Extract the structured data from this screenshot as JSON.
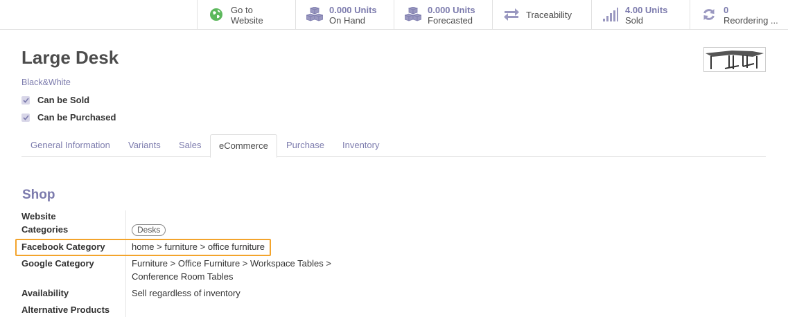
{
  "smart_buttons": [
    {
      "value": "",
      "label_line1": "Go to",
      "label_line2": "Website",
      "icon": "globe-icon"
    },
    {
      "value": "0.000 Units",
      "label": "On Hand",
      "icon": "cubes-icon"
    },
    {
      "value": "0.000 Units",
      "label": "Forecasted",
      "icon": "cubes-icon"
    },
    {
      "value": "",
      "label": "Traceability",
      "icon": "arrows-exchange-icon"
    },
    {
      "value": "4.00 Units",
      "label": "Sold",
      "icon": "signal-bars-icon"
    },
    {
      "value": "0",
      "label": "Reordering ...",
      "icon": "refresh-icon"
    }
  ],
  "product": {
    "name": "Large Desk",
    "variant_tag": "Black&White",
    "can_be_sold": {
      "label": "Can be Sold",
      "checked": true
    },
    "can_be_purchased": {
      "label": "Can be Purchased",
      "checked": true
    }
  },
  "tabs": [
    {
      "label": "General Information",
      "active": false
    },
    {
      "label": "Variants",
      "active": false
    },
    {
      "label": "Sales",
      "active": false
    },
    {
      "label": "eCommerce",
      "active": true
    },
    {
      "label": "Purchase",
      "active": false
    },
    {
      "label": "Inventory",
      "active": false
    }
  ],
  "shop": {
    "title": "Shop",
    "website_label": "Website",
    "categories_label": "Categories",
    "categories_tag": "Desks",
    "facebook_label": "Facebook Category",
    "facebook_value": "home > furniture > office furniture",
    "google_label": "Google Category",
    "google_value_line1": "Furniture > Office Furniture > Workspace Tables >",
    "google_value_line2": "Conference Room Tables",
    "availability_label": "Availability",
    "availability_value": "Sell regardless of inventory",
    "alternative_label": "Alternative Products"
  },
  "colors": {
    "accent": "#7c7bad",
    "highlight": "#f3a42c",
    "globe": "#5cb85c"
  }
}
